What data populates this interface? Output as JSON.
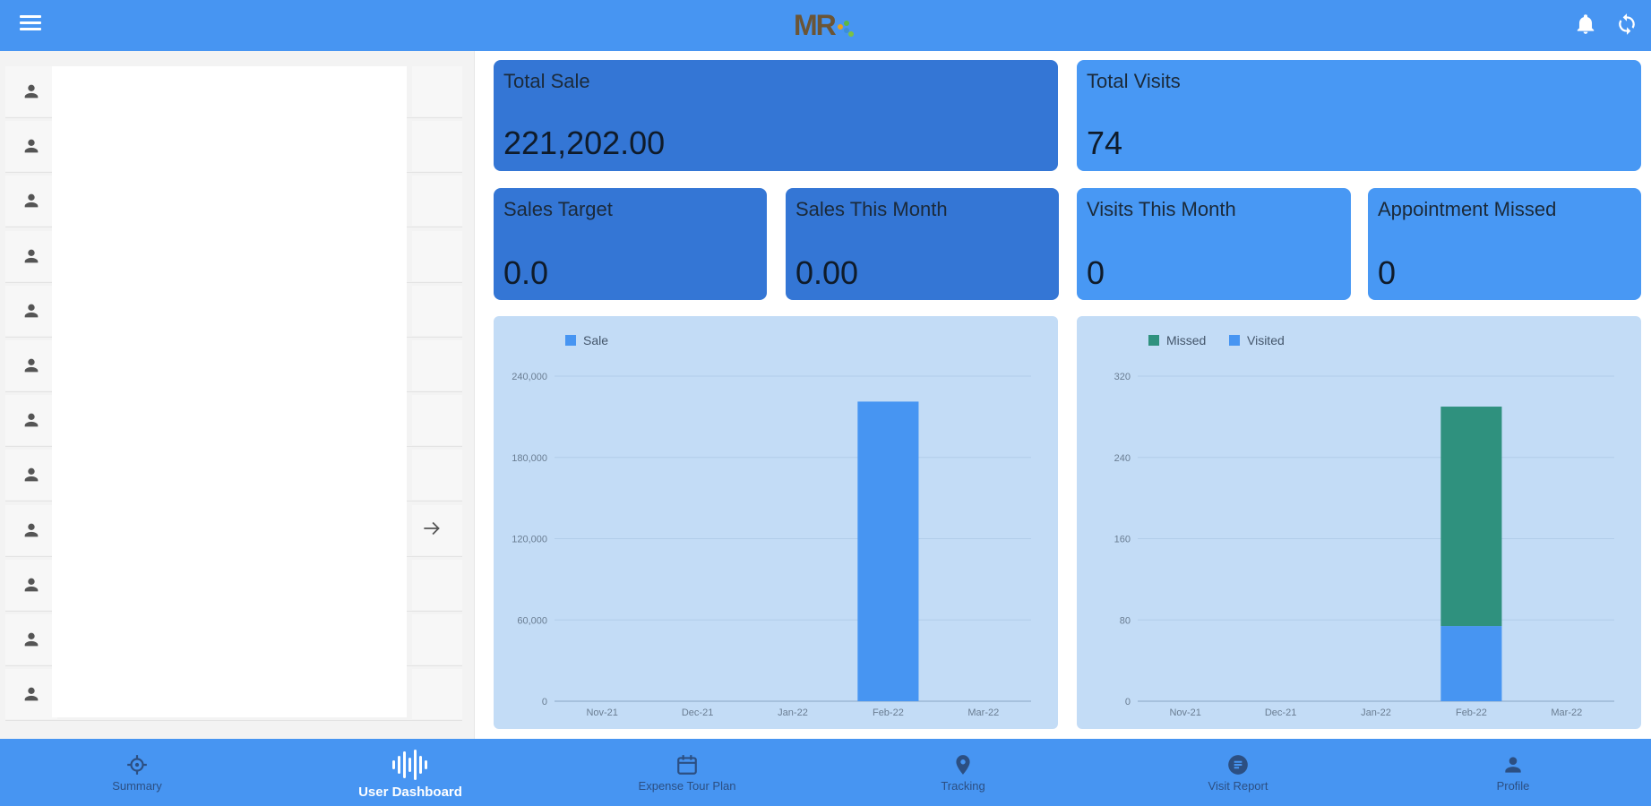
{
  "header": {
    "logo_text": "MR",
    "colors": {
      "bar": "#4795f2",
      "logo": "#6b5536"
    }
  },
  "left_panel": {
    "row_count": 12
  },
  "cards": {
    "total_sale": {
      "label": "Total Sale",
      "value": "221,202.00"
    },
    "total_visits": {
      "label": "Total Visits",
      "value": "74"
    },
    "sales_target": {
      "label": "Sales Target",
      "value": "0.0"
    },
    "sales_this_month": {
      "label": "Sales This Month",
      "value": "0.00"
    },
    "visits_this_month": {
      "label": "Visits This Month",
      "value": "0"
    },
    "appointment_missed": {
      "label": "Appointment Missed",
      "value": "0"
    }
  },
  "chart_data": [
    {
      "type": "bar",
      "categories": [
        "Nov-21",
        "Dec-21",
        "Jan-22",
        "Feb-22",
        "Mar-22"
      ],
      "series": [
        {
          "name": "Sale",
          "values": [
            0,
            0,
            0,
            221202,
            0
          ],
          "color": "#4795f2"
        }
      ],
      "yticks": [
        "0",
        "60,000",
        "120,000",
        "180,000",
        "240,000"
      ],
      "ylim": [
        0,
        240000
      ],
      "legend": "top-left",
      "grid": true
    },
    {
      "type": "bar",
      "stacked": true,
      "categories": [
        "Nov-21",
        "Dec-21",
        "Jan-22",
        "Feb-22",
        "Mar-22"
      ],
      "series": [
        {
          "name": "Visited",
          "values": [
            0,
            0,
            0,
            74,
            0
          ],
          "color": "#4795f2"
        },
        {
          "name": "Missed",
          "values": [
            0,
            0,
            0,
            216,
            0
          ],
          "color": "#2f917e"
        }
      ],
      "legend_order": [
        "Missed",
        "Visited"
      ],
      "yticks": [
        "0",
        "80",
        "160",
        "240",
        "320"
      ],
      "ylim": [
        0,
        320
      ],
      "legend": "top-left",
      "grid": true
    }
  ],
  "bottom_nav": {
    "items": [
      {
        "label": "Summary",
        "icon": "target-icon"
      },
      {
        "label": "User Dashboard",
        "icon": "waveform-icon",
        "active": true
      },
      {
        "label": "Expense Tour Plan",
        "icon": "calendar-icon"
      },
      {
        "label": "Tracking",
        "icon": "location-pin-icon"
      },
      {
        "label": "Visit Report",
        "icon": "report-icon"
      },
      {
        "label": "Profile",
        "icon": "person-icon"
      }
    ]
  }
}
